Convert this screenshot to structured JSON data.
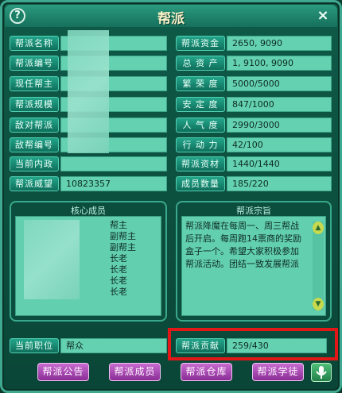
{
  "window": {
    "title": "帮派",
    "help_label": "?",
    "close_label": "×"
  },
  "left_fields": [
    {
      "label": "帮派名称",
      "value": ""
    },
    {
      "label": "帮派编号",
      "value": ""
    },
    {
      "label": "现任帮主",
      "value": ""
    },
    {
      "label": "帮派规模",
      "value": ""
    },
    {
      "label": "敌对帮派",
      "value": ""
    },
    {
      "label": "敌帮编号",
      "value": ""
    },
    {
      "label": "当前内政",
      "value": ""
    },
    {
      "label": "帮派威望",
      "value": "10823357"
    }
  ],
  "right_fields": [
    {
      "label": "帮派资金",
      "value": "2650, 9090"
    },
    {
      "label": "总 资 产",
      "value": "1, 9100, 9090"
    },
    {
      "label": "繁 荣 度",
      "value": "5000/5000"
    },
    {
      "label": "安 定 度",
      "value": "847/1000"
    },
    {
      "label": "人 气 度",
      "value": "2990/3000"
    },
    {
      "label": "行 动 力",
      "value": "42/100"
    },
    {
      "label": "帮派资材",
      "value": "1440/1440"
    },
    {
      "label": "成员数量",
      "value": "185/220"
    }
  ],
  "core_members": {
    "title": "核心成员",
    "roles": [
      "帮主",
      "副帮主",
      "副帮主",
      "长老",
      "长老",
      "长老",
      "长老"
    ]
  },
  "motto": {
    "title": "帮派宗旨",
    "lines": [
      "帮派降魔在每周一、周三帮战",
      "后开启。每周跑14票商的奖励",
      "盒子一个。希望大家积极参加",
      "帮派活动。团结一致发展帮派"
    ]
  },
  "current_position": {
    "label": "当前职位",
    "value": "帮众"
  },
  "contribution": {
    "label": "帮派贡献",
    "value": "259/430"
  },
  "buttons": {
    "notice": "帮派公告",
    "members": "帮派成员",
    "warehouse": "帮派仓库",
    "apprentice": "帮派学徒"
  },
  "colors": {
    "highlight": "#e21818",
    "button": "#a94ab4",
    "field": "#64d1b0"
  }
}
